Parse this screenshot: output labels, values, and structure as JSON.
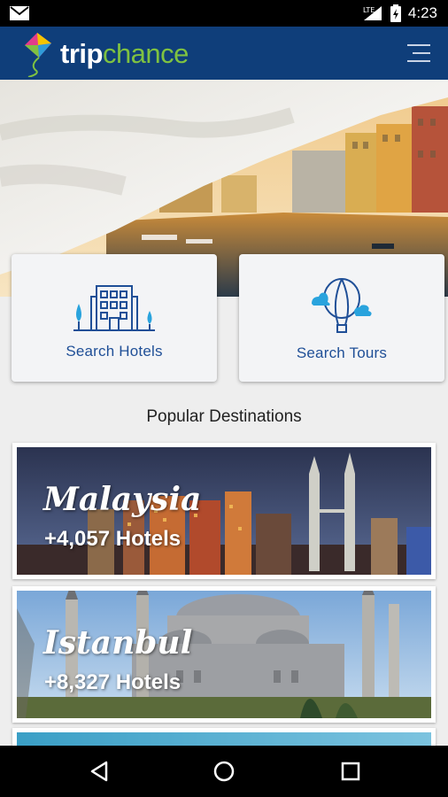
{
  "status_bar": {
    "time": "4:23",
    "network": "LTE",
    "icons": [
      "gmail-icon",
      "signal-icon",
      "battery-icon"
    ]
  },
  "app_bar": {
    "logo_part1": "trip",
    "logo_part2": "chance",
    "menu_icon": "hamburger-menu-icon"
  },
  "actions": {
    "hotels_label": "Search Hotels",
    "tours_label": "Search Tours"
  },
  "section_title": "Popular Destinations",
  "destinations": [
    {
      "name": "Malaysia",
      "count": "+4,057 Hotels"
    },
    {
      "name": "Istanbul",
      "count": "+8,327  Hotels"
    }
  ],
  "nav_icons": [
    "back-icon",
    "home-icon",
    "recents-icon"
  ],
  "colors": {
    "app_bar": "#0f3e7a",
    "logo_accent": "#7fc241",
    "action_text": "#1f4f97"
  }
}
